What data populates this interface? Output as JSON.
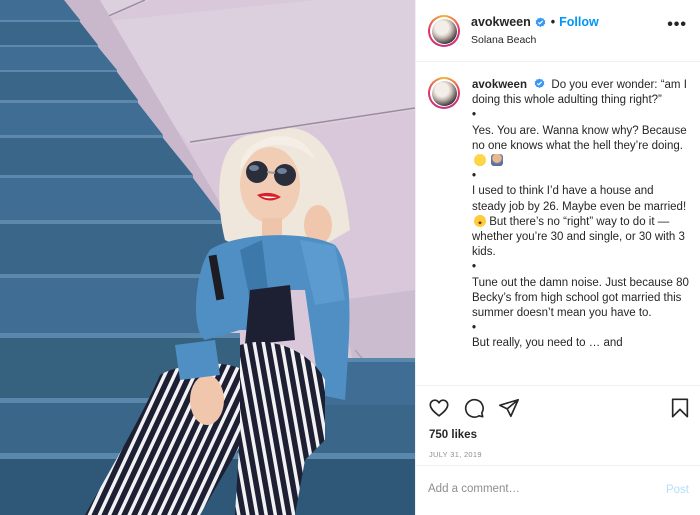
{
  "photo": {
    "alt": "Woman with platinum blonde hair, round sunglasses, denim jacket and striped jumpsuit sitting on blue stairs against a lilac wall",
    "colors": {
      "wall": "#d8c8da",
      "wall_shade": "#c9b8cc",
      "stair": "#3f6d93",
      "stair_edge": "#5d89ad",
      "stair_dark": "#2f5878",
      "denim": "#4f8fc4",
      "stripe_dark": "#1d1f33",
      "stripe_light": "#f2f2f4",
      "hair": "#efe7dc",
      "skin": "#f2cdb6",
      "lips": "#d8202a"
    }
  },
  "header": {
    "username": "avokween",
    "verified_icon": "verified-badge-icon",
    "separator": "•",
    "follow_label": "Follow",
    "location": "Solana Beach",
    "more_label": "•••"
  },
  "caption": {
    "username": "avokween",
    "paragraphs": [
      "Do you ever wonder: “am I doing this whole adulting thing right?”",
      "Yes. You are. Wanna know why? Because no one knows what the hell they’re doing.",
      "I used to think I’d have a house and steady job by 26. Maybe even be married!",
      "But there’s no “right” way to do it — whether you’re 30 and single, or 30 with 3 kids.",
      "Tune out the damn noise. Just because 80 Becky’s from high school got married this summer doesn’t mean you have to.",
      "But really, you need to … and"
    ],
    "bullet": "•",
    "emojis": [
      "face-with-tears-of-joy",
      "person-shrugging",
      "face-with-open-mouth"
    ]
  },
  "actions": {
    "like_icon": "heart-icon",
    "comment_icon": "comment-icon",
    "share_icon": "share-icon",
    "save_icon": "bookmark-icon",
    "likes": "750 likes",
    "date": "JULY 31, 2019"
  },
  "comment": {
    "placeholder": "Add a comment…",
    "post_label": "Post"
  },
  "colors": {
    "accent": "#0095f6",
    "post_disabled": "#b2dffc",
    "text": "#262626",
    "muted": "#8e8e8e",
    "divider": "#efefef"
  }
}
